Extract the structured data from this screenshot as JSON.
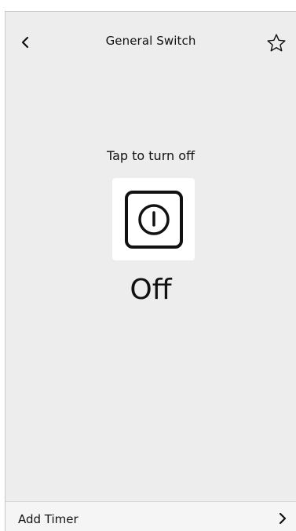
{
  "header": {
    "title": "General Switch",
    "back_icon": "chevron-left-icon",
    "favorite_icon": "star-outline-icon"
  },
  "main": {
    "hint": "Tap to turn off",
    "power_icon": "power-icon",
    "state": "Off"
  },
  "footer": {
    "label": "Add Timer",
    "chevron_icon": "chevron-right-icon"
  },
  "colors": {
    "background": "#ededed",
    "tile": "#ffffff",
    "text": "#111111"
  }
}
